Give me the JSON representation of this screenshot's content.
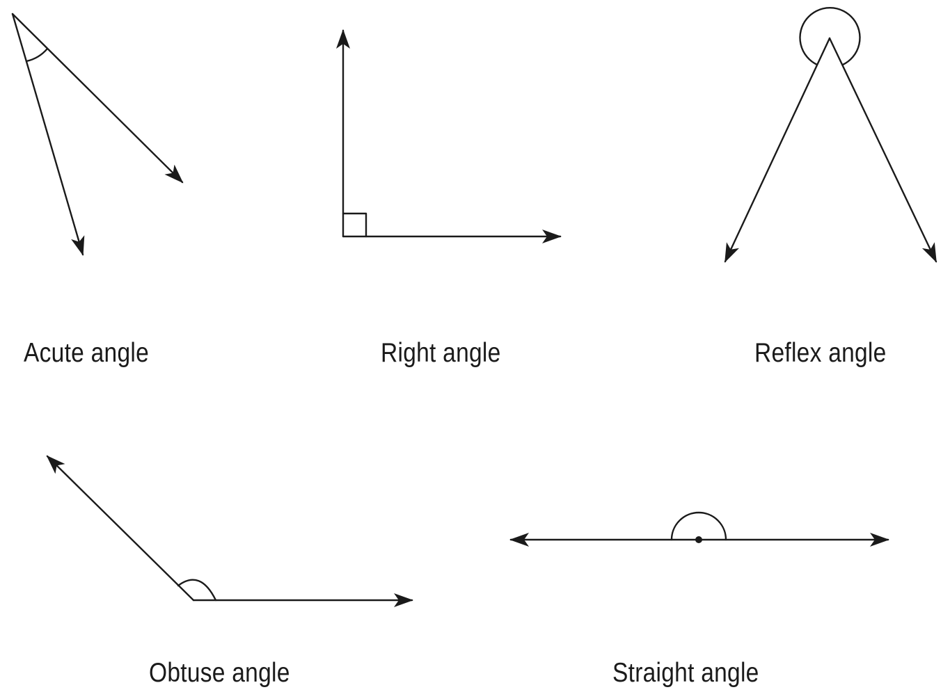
{
  "figure": {
    "angles": [
      {
        "id": "acute",
        "label": "Acute angle"
      },
      {
        "id": "right",
        "label": "Right angle"
      },
      {
        "id": "reflex",
        "label": "Reflex angle"
      },
      {
        "id": "obtuse",
        "label": "Obtuse angle"
      },
      {
        "id": "straight",
        "label": "Straight angle"
      }
    ]
  },
  "style": {
    "stroke_color": "#1a1a1a",
    "background": "#ffffff"
  }
}
